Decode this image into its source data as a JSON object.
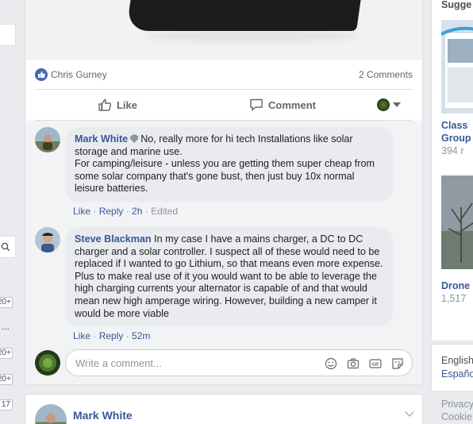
{
  "left_rail": {
    "badges": [
      "20+",
      "20+",
      "20+",
      "17"
    ],
    "dots": "..."
  },
  "post": {
    "reaction_name": "Chris Gurney",
    "comment_count": "2 Comments",
    "actions": {
      "like": "Like",
      "comment": "Comment"
    }
  },
  "comments": [
    {
      "author": "Mark White",
      "text": "No, really more for hi tech Installations like solar storage and marine use.",
      "text2": "For camping/leisure - unless you are getting them super cheap from some solar company that's gone bust, then just buy 10x normal leisure batteries.",
      "like": "Like",
      "reply": "Reply",
      "time": "2h",
      "edited": "Edited"
    },
    {
      "author": "Steve Blackman",
      "text": "In my case I have a mains charger, a DC to DC charger and a solar controller. I suspect all of these would need to be replaced if I wanted to go Lithium, so that means even more expense. Plus to make real use of it you would want to be able to leverage the high charging currents your alternator is capable of and that would mean new high amperage wiring. However, building a new camper it would be more viable",
      "like": "Like",
      "reply": "Reply",
      "time": "52m"
    }
  ],
  "compose": {
    "placeholder": "Write a comment..."
  },
  "next_post": {
    "author": "Mark White"
  },
  "right_column": {
    "header": "Sugge",
    "item1": {
      "title": "Class",
      "subtitle": "Group",
      "count": "394 r"
    },
    "item2": {
      "title": "Drone",
      "count": "1,517"
    },
    "languages": [
      "English",
      "Españo"
    ],
    "footer": [
      "Privacy",
      "Cookie"
    ]
  },
  "colors": {
    "link": "#385898",
    "meta": "#90949c",
    "bubble": "#e9ebee",
    "like_blue": "#4267b2"
  }
}
